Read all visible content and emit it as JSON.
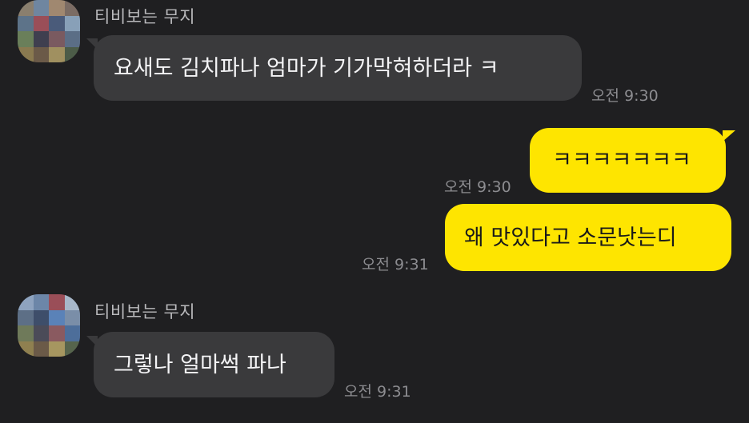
{
  "colors": {
    "background": "#1f1f21",
    "incoming_bubble": "#3a3a3c",
    "outgoing_bubble": "#fee500",
    "sender_name": "#b9b9bc",
    "timestamp": "#8c8c90"
  },
  "messages": [
    {
      "direction": "incoming",
      "sender": "티비보는 무지",
      "text": "요새도 김치파나 엄마가 기가막혀하더라 ㅋ",
      "time": "오전 9:30"
    },
    {
      "direction": "outgoing",
      "text": "ㅋㅋㅋㅋㅋㅋㅋ",
      "time": "오전 9:30"
    },
    {
      "direction": "outgoing",
      "text": "왜 맛있다고 소문낫는디",
      "time": "오전 9:31"
    },
    {
      "direction": "incoming",
      "sender": "티비보는 무지",
      "text": "그렇나 얼마썩 파나",
      "time": "오전 9:31"
    }
  ]
}
